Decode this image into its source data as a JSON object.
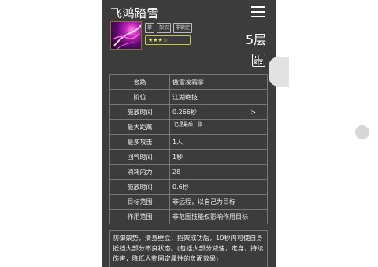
{
  "header": {
    "title": "飞鸿踏雪",
    "menu_icon": "hamburger-menu-icon"
  },
  "skill": {
    "icon": "skill-art-icon",
    "tags": [
      "掌",
      "架招",
      "非锁定"
    ],
    "stars": "★★★☆",
    "layer": "5层",
    "calc_icon": "calculator-icon"
  },
  "attributes": [
    {
      "key": "套路",
      "value": "傲雪凌霜掌"
    },
    {
      "key": "阶位",
      "value": "江湖绝技"
    },
    {
      "key": "施放时间",
      "value": "0.266秒",
      "arrow": ">"
    },
    {
      "key": "最大距离",
      "value": ""
    },
    {
      "key": "最多攻击",
      "value": "1人"
    },
    {
      "key": "回气时间",
      "value": "1秒"
    },
    {
      "key": "消耗内力",
      "value": "28"
    },
    {
      "key": "施放时间",
      "value": "0.6秒"
    },
    {
      "key": "目标范围",
      "value": "非远程，以自己为目标"
    },
    {
      "key": "作用范围",
      "value": "非范围技能仅影响作用目标"
    }
  ],
  "tooltip": "已是最后一张",
  "description": "防御架势，清身壁立，招架成功后，10秒内可使自身抵挡大部分不良状态。(包括大部分减速，定身，持续伤害，降低人物固定属性的负面效果)",
  "colors": {
    "panel_bg": "#3c3c3c",
    "star_border": "#c8c83a"
  }
}
